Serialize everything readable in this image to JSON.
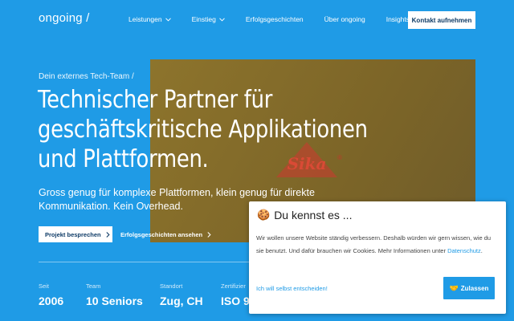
{
  "nav": {
    "logo": "ongoing /",
    "items": [
      {
        "label": "Leistungen",
        "has_dropdown": true
      },
      {
        "label": "Einstieg",
        "has_dropdown": true
      },
      {
        "label": "Erfolgsgeschichten",
        "has_dropdown": false
      },
      {
        "label": "Über ongoing",
        "has_dropdown": false
      },
      {
        "label": "Insights",
        "has_dropdown": false
      }
    ],
    "cta_label": "Kontakt aufnehmen"
  },
  "hero": {
    "eyebrow": "Dein externes Tech-Team /",
    "headline_lines": [
      "Technischer Partner für",
      "geschäftskritische Applikationen",
      "und Plattformen."
    ],
    "subtitle": "Gross genug für komplexe Plattformen, klein genug für direkte Kommunikation. Kein Overhead.",
    "primary_button": "Projekt besprechen",
    "secondary_button": "Erfolgsgeschichten ansehen",
    "image_logo_text": "Sika",
    "image_logo_mark": "®"
  },
  "stats": [
    {
      "label": "Seit",
      "value": "2006"
    },
    {
      "label": "Team",
      "value": "10 Seniors"
    },
    {
      "label": "Standort",
      "value": "Zug, CH"
    },
    {
      "label": "Zertifizier",
      "value": "ISO 9"
    }
  ],
  "cookie": {
    "emoji": "🍪",
    "title": "Du kennst es ...",
    "text": "Wir wollen unsere Website ständig verbessern. Deshalb würden wir gern wissen, wie du sie benutzt. Und dafür brauchen wir Cookies. Mehr Informationen unter",
    "link": "Datenschutz",
    "link_suffix": ".",
    "choose_label": "Ich will selbst entscheiden!",
    "accept_emoji": "🤝",
    "accept_label": "Zulassen"
  },
  "colors": {
    "background": "#1f9be6",
    "image_tint": "#8d742c",
    "sika_red": "#c0392b",
    "button_text": "#0e3b66"
  }
}
